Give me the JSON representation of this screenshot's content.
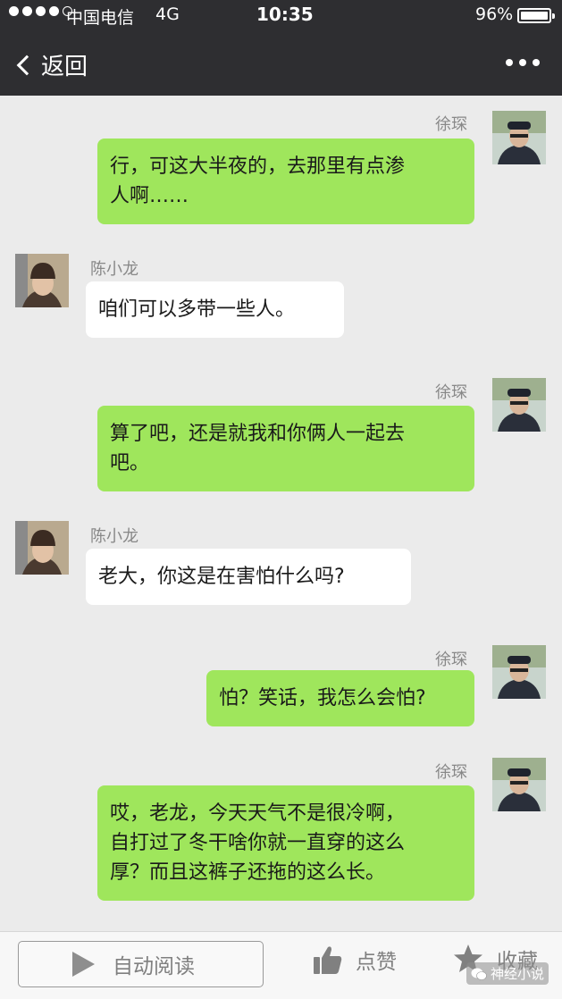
{
  "status_bar": {
    "carrier": "中国电信",
    "network": "4G",
    "time": "10:35",
    "battery": "96%",
    "battery_level": 0.96
  },
  "nav": {
    "back_label": "返回",
    "more_icon": "more-dots-icon"
  },
  "messages": [
    {
      "sender": "徐琛",
      "side": "right",
      "text_lines": [
        "行，可这大半夜的，去那里有点渗",
        "人啊……"
      ]
    },
    {
      "sender": "陈小龙",
      "side": "left",
      "text_lines": [
        "咱们可以多带一些人。"
      ]
    },
    {
      "sender": "徐琛",
      "side": "right",
      "text_lines": [
        "算了吧，还是就我和你俩人一起去",
        "吧。"
      ]
    },
    {
      "sender": "陈小龙",
      "side": "left",
      "text_lines": [
        "老大，你这是在害怕什么吗?"
      ]
    },
    {
      "sender": "徐琛",
      "side": "right",
      "text_lines": [
        "怕？笑话，我怎么会怕?"
      ]
    },
    {
      "sender": "徐琛",
      "side": "right",
      "text_lines": [
        "哎，老龙，今天天气不是很冷啊，",
        "自打过了冬干啥你就一直穿的这么",
        "厚？而且这裤子还拖的这么长。"
      ]
    }
  ],
  "toolbar": {
    "auto_read": "自动阅读",
    "like": "点赞",
    "favorite": "收藏"
  },
  "watermark": "神经小说",
  "colors": {
    "header_bg": "#2e2e31",
    "chat_bg": "#ebebeb",
    "bubble_self": "#9fe65c",
    "bubble_other": "#ffffff"
  }
}
